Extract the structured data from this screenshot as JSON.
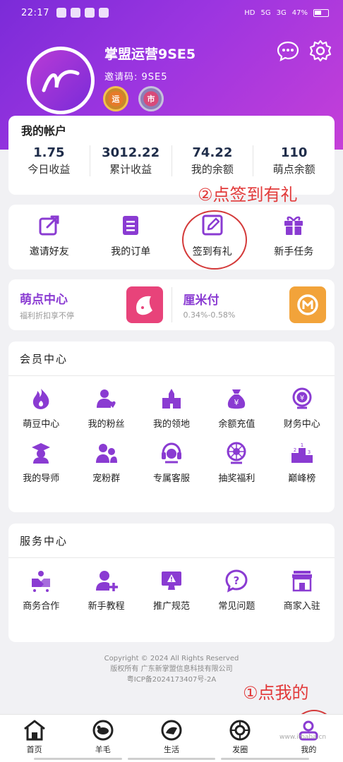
{
  "status_bar": {
    "time": "22:17",
    "signal1": "5G",
    "signal2": "3G",
    "battery": "47%",
    "hd": "HD"
  },
  "profile": {
    "username": "掌盟运营9SE5",
    "invite_label": "邀请码: 9SE5",
    "badge1": "运",
    "badge2": "市"
  },
  "header_icons": [
    "message-icon",
    "settings-gear-icon"
  ],
  "account": {
    "title": "我的帐户",
    "stats": [
      {
        "value": "1.75",
        "label": "今日收益"
      },
      {
        "value": "3012.22",
        "label": "累计收益"
      },
      {
        "value": "74.22",
        "label": "我的余额"
      },
      {
        "value": "110",
        "label": "萌点余额"
      }
    ]
  },
  "annotations": {
    "step2": "②点签到有礼",
    "step1": "①点我的"
  },
  "quick_actions": [
    {
      "label": "邀请好友",
      "icon": "share-icon"
    },
    {
      "label": "我的订单",
      "icon": "order-icon"
    },
    {
      "label": "签到有礼",
      "icon": "sign-in-edit-icon"
    },
    {
      "label": "新手任务",
      "icon": "gift-icon"
    }
  ],
  "promos": [
    {
      "title": "萌点中心",
      "subtitle": "福利折扣享不停",
      "color": "#e8437a"
    },
    {
      "title": "厘米付",
      "subtitle": "0.34%-0.58%",
      "color": "#f2a33a"
    }
  ],
  "member_center": {
    "title": "会员中心",
    "items": [
      {
        "label": "萌豆中心",
        "icon": "flame-icon"
      },
      {
        "label": "我的粉丝",
        "icon": "fans-icon"
      },
      {
        "label": "我的领地",
        "icon": "castle-icon"
      },
      {
        "label": "余额充值",
        "icon": "money-bag-icon"
      },
      {
        "label": "财务中心",
        "icon": "finance-icon"
      },
      {
        "label": "我的导师",
        "icon": "mentor-icon"
      },
      {
        "label": "宠粉群",
        "icon": "group-icon"
      },
      {
        "label": "专属客服",
        "icon": "customer-service-icon"
      },
      {
        "label": "抽奖福利",
        "icon": "lottery-icon"
      },
      {
        "label": "巅峰榜",
        "icon": "podium-icon"
      }
    ]
  },
  "service_center": {
    "title": "服务中心",
    "items": [
      {
        "label": "商务合作",
        "icon": "handshake-icon"
      },
      {
        "label": "新手教程",
        "icon": "add-user-icon"
      },
      {
        "label": "推广规范",
        "icon": "warning-monitor-icon"
      },
      {
        "label": "常见问题",
        "icon": "question-icon"
      },
      {
        "label": "商家入驻",
        "icon": "store-icon"
      }
    ]
  },
  "footer": {
    "line1": "Copyright © 2024 All Rights Reserved",
    "line2": "版权所有 广东新掌盟信息科技有限公司",
    "line3": "粤ICP备2024173407号-2A"
  },
  "tabs": [
    {
      "label": "首页",
      "icon": "home-icon"
    },
    {
      "label": "羊毛",
      "icon": "sheep-icon"
    },
    {
      "label": "生活",
      "icon": "life-icon"
    },
    {
      "label": "发圈",
      "icon": "moments-icon"
    },
    {
      "label": "我的",
      "icon": "profile-icon"
    }
  ],
  "watermark": "www.itbaba.cn",
  "colors": {
    "accent": "#8a3bd2",
    "annotation": "#e23a3a"
  }
}
